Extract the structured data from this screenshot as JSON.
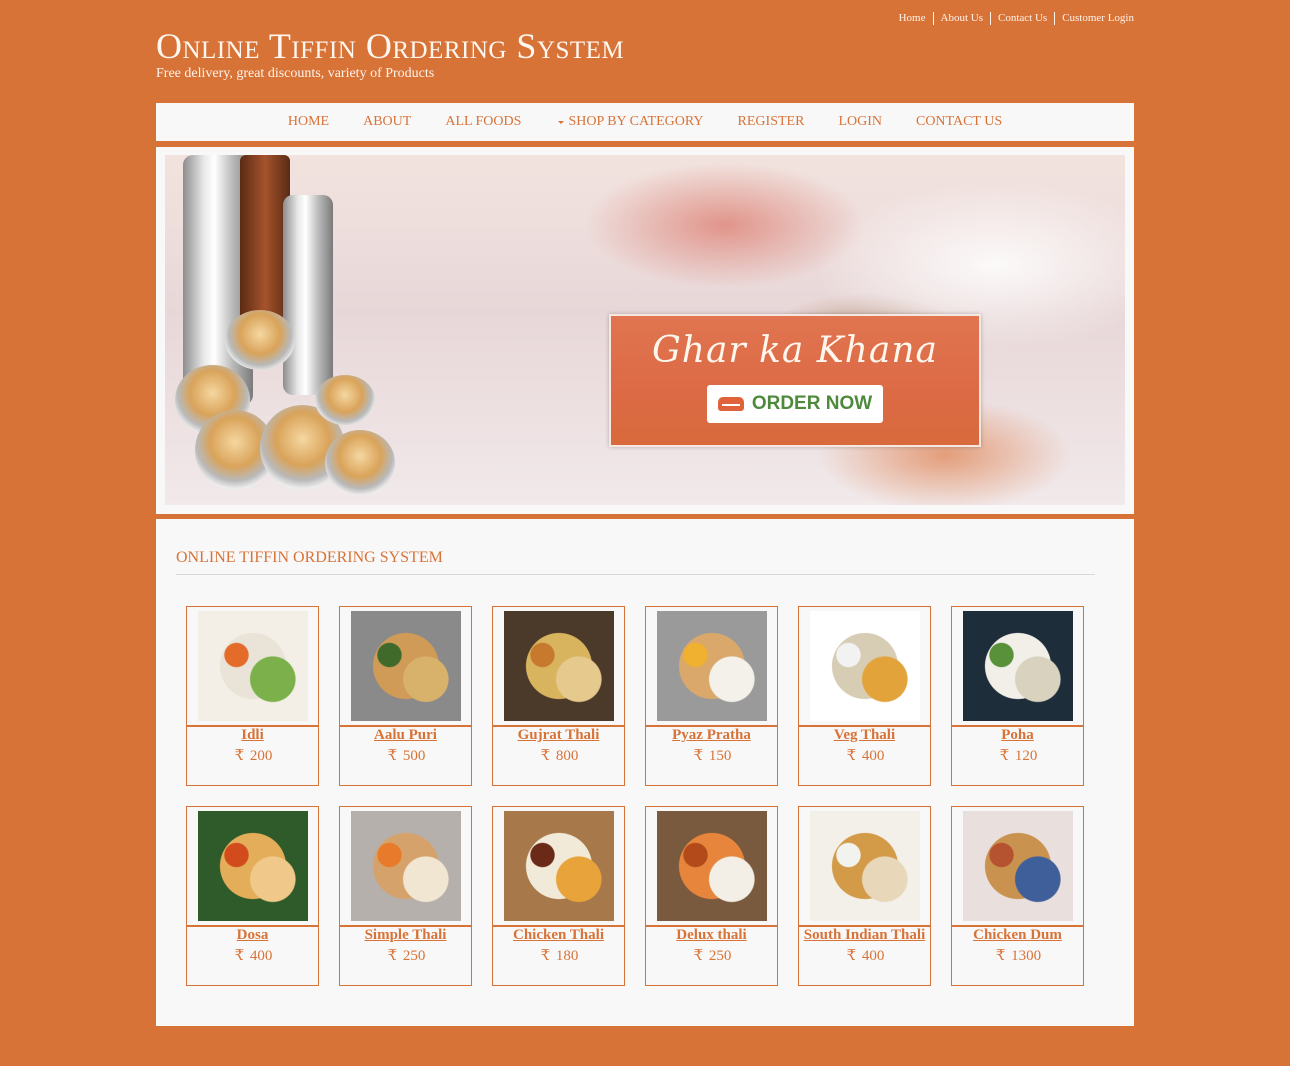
{
  "top_links": [
    "Home",
    "About Us",
    "Contact Us",
    "Customer Login"
  ],
  "site": {
    "title": "Online Tiffin Ordering System",
    "tagline": "Free delivery, great discounts, variety of Products"
  },
  "nav": {
    "items": [
      "HOME",
      "ABOUT",
      "ALL FOODS",
      "SHOP BY CATEGORY",
      "REGISTER",
      "LOGIN",
      "CONTACT US"
    ]
  },
  "banner": {
    "script_text": "Ghar ka Khana",
    "button_label": "ORDER NOW",
    "button_icon": "tiffin-box-icon"
  },
  "section": {
    "title": "ONLINE TIFFIN ORDERING SYSTEM"
  },
  "currency_symbol": "₹",
  "products": [
    {
      "name": "Idli",
      "price": "200",
      "image": "idli-image"
    },
    {
      "name": "Aalu Puri",
      "price": "500",
      "image": "aalu-puri-image"
    },
    {
      "name": "Gujrat Thali",
      "price": "800",
      "image": "gujrat-thali-image"
    },
    {
      "name": "Pyaz Pratha",
      "price": "150",
      "image": "pyaz-pratha-image"
    },
    {
      "name": "Veg Thali",
      "price": "400",
      "image": "veg-thali-image"
    },
    {
      "name": "Poha",
      "price": "120",
      "image": "poha-image"
    },
    {
      "name": "Dosa",
      "price": "400",
      "image": "dosa-image"
    },
    {
      "name": "Simple Thali",
      "price": "250",
      "image": "simple-thali-image"
    },
    {
      "name": "Chicken Thali",
      "price": "180",
      "image": "chicken-thali-image"
    },
    {
      "name": "Delux thali",
      "price": "250",
      "image": "delux-thali-image"
    },
    {
      "name": "South Indian Thali",
      "price": "400",
      "image": "south-indian-thali-image"
    },
    {
      "name": "Chicken Dum",
      "price": "1300",
      "image": "chicken-dum-image"
    }
  ],
  "colors": {
    "brand": "#d87338",
    "panel": "#f8f8f8",
    "order_button_text": "#4f8a3c"
  }
}
